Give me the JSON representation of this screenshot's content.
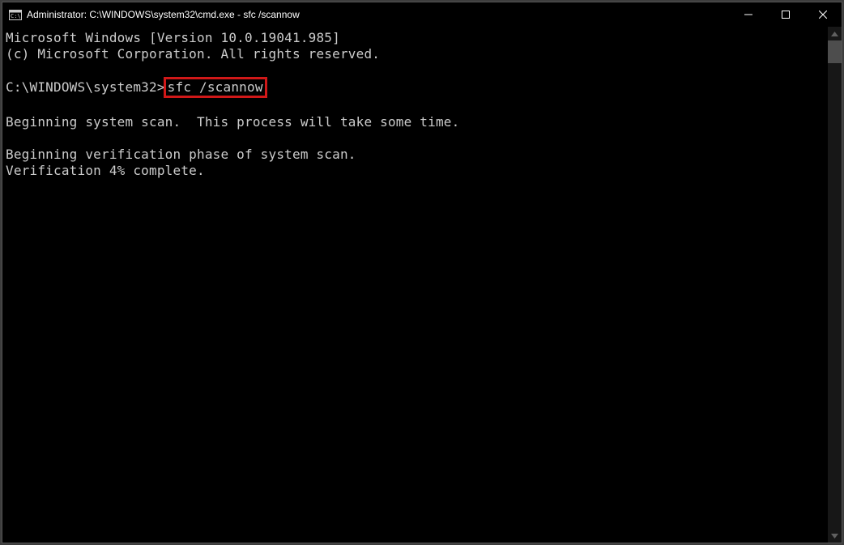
{
  "window": {
    "title": "Administrator: C:\\WINDOWS\\system32\\cmd.exe - sfc  /scannow"
  },
  "console": {
    "line1": "Microsoft Windows [Version 10.0.19041.985]",
    "line2": "(c) Microsoft Corporation. All rights reserved.",
    "blank": "",
    "prompt_prefix": "C:\\WINDOWS\\system32>",
    "command": "sfc /scannow",
    "line5": "Beginning system scan.  This process will take some time.",
    "line7": "Beginning verification phase of system scan.",
    "line8": "Verification 4% complete."
  }
}
